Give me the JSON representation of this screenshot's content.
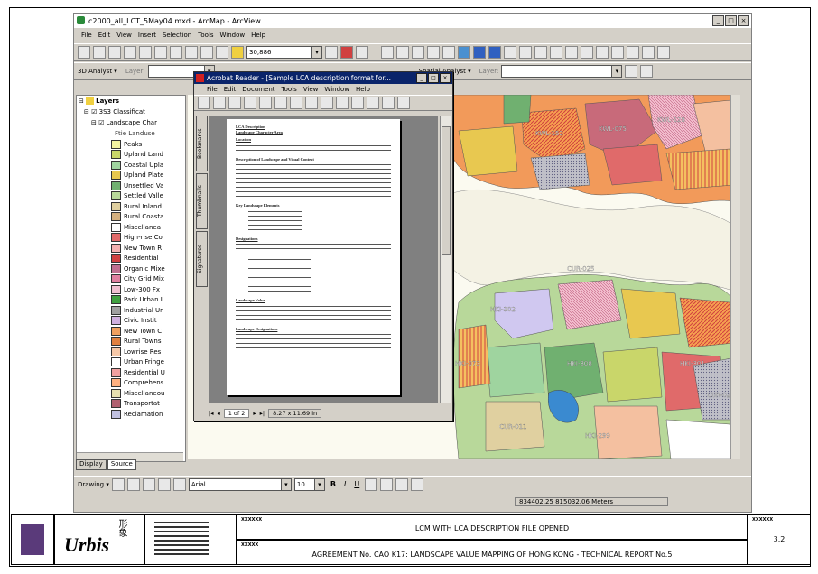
{
  "window": {
    "title": "c2000_all_LCT_5May04.mxd - ArcMap - ArcView",
    "controls": [
      "_",
      "□",
      "×"
    ]
  },
  "menu": [
    "File",
    "Edit",
    "View",
    "Insert",
    "Selection",
    "Tools",
    "Window",
    "Help"
  ],
  "toolbar": {
    "scale": "30,886",
    "analyst_3d": "3D Analyst ▾",
    "layer_label": "Layer:",
    "spatial_analyst": "Spatial Analyst ▾",
    "layer_label2": "Layer:"
  },
  "toc": {
    "root": "Layers",
    "group1": "3S3 Classificat",
    "group2": "Landscape Char",
    "group2_sub": "Ftie Landuse",
    "items": [
      {
        "label": "Peaks",
        "color": "#f2f2a0"
      },
      {
        "label": "Upland Land",
        "color": "#c9d66a"
      },
      {
        "label": "Coastal Upla",
        "color": "#9fd49f"
      },
      {
        "label": "Upland Plate",
        "color": "#e8c84e"
      },
      {
        "label": "Unsettled Va",
        "color": "#70b070"
      },
      {
        "label": "Settled Valle",
        "color": "#b8d89a"
      },
      {
        "label": "Rural Inland",
        "color": "#e0d0a0"
      },
      {
        "label": "Rural Coasta",
        "color": "#d4b080"
      },
      {
        "label": "Miscellanea",
        "color": "#ffffff"
      },
      {
        "label": "High-rise Co",
        "color": "#e06a6a"
      },
      {
        "label": "New Town R",
        "color": "#f4b0b0"
      },
      {
        "label": "Residential",
        "color": "#d04040"
      },
      {
        "label": "Organic Mixe",
        "color": "#c07090"
      },
      {
        "label": "City Grid Mix",
        "color": "#e080a0"
      },
      {
        "label": "Low-300 Fx",
        "color": "#f0c0d0"
      },
      {
        "label": "Park Urban L",
        "color": "#40a040"
      },
      {
        "label": "Industrial Ur",
        "color": "#a0a0a0"
      },
      {
        "label": "Civic Instit",
        "color": "#d0b0e0"
      },
      {
        "label": "New Town C",
        "color": "#f0a060"
      },
      {
        "label": "Rural Towns",
        "color": "#e08040"
      },
      {
        "label": "Lowrise Res",
        "color": "#f6c8a8"
      },
      {
        "label": "Urban Fringe",
        "color": "#ffffff"
      },
      {
        "label": "Residential U",
        "color": "#f0a0a0"
      },
      {
        "label": "Comprehens",
        "color": "#ffb080"
      },
      {
        "label": "Miscellaneou",
        "color": "#e6e0b0"
      },
      {
        "label": "Transportat",
        "color": "#b06070"
      },
      {
        "label": "Reclamation",
        "color": "#c0c0e0"
      }
    ],
    "tabs": [
      "Display",
      "Source"
    ]
  },
  "acrobat": {
    "title": "Acrobat Reader - [Sample LCA description format for...",
    "menu": [
      "File",
      "Edit",
      "Document",
      "Tools",
      "View",
      "Window",
      "Help"
    ],
    "side_tabs": [
      "Bookmarks",
      "Thumbnails",
      "Signatures"
    ],
    "page_status": "1 of 2",
    "page_size": "8.27 x 11.69 in",
    "doc": {
      "heading1": "LCA Description",
      "heading2": "Landscape Character Area",
      "sec1": "Location",
      "sec2": "Description of Landscape and Visual Context",
      "sec3": "Key Landscape Elements",
      "sec4": "Designations",
      "sec5": "Landscape Value",
      "sec6": "Landscape Designations"
    }
  },
  "map_labels": [
    "KWL-075",
    "KWL-152",
    "KWL-128",
    "HKI-302",
    "HKI-308",
    "HKI-301",
    "CUR-027",
    "CUR-011",
    "HKI-299",
    "HKI-073",
    "CUR-025"
  ],
  "drawing": {
    "label": "Drawing ▾",
    "font": "Arial",
    "size": "10",
    "bold": "B",
    "italic": "I",
    "underline": "U"
  },
  "status": {
    "coord": "834402.25  815032.06 Meters"
  },
  "titleblock": {
    "logo_text": "Urbis",
    "chinese": "形象",
    "code1": "XXXXXX",
    "code2": "XXXXX",
    "code3": "XXXXXX",
    "title": "LCM WITH LCA DESCRIPTION FILE OPENED",
    "agreement": "AGREEMENT No. CAO K17: LANDSCAPE VALUE MAPPING OF HONG KONG - TECHNICAL REPORT No.5",
    "figure_no": "3.2"
  }
}
